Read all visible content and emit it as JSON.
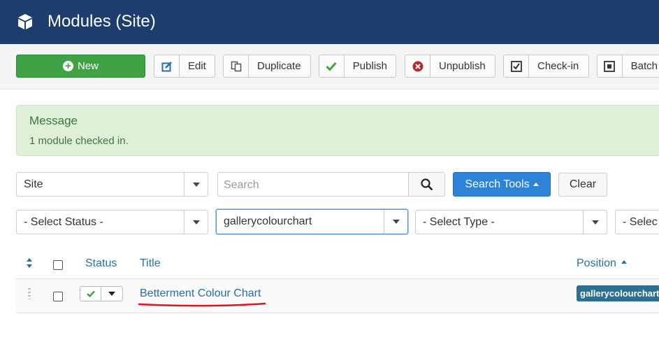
{
  "header": {
    "title": "Modules (Site)"
  },
  "toolbar": {
    "new": "New",
    "edit": "Edit",
    "duplicate": "Duplicate",
    "publish": "Publish",
    "unpublish": "Unpublish",
    "checkin": "Check-in",
    "batch": "Batch"
  },
  "message": {
    "heading": "Message",
    "text": "1 module checked in."
  },
  "filters": {
    "client": "Site",
    "search_placeholder": "Search",
    "search_tools": "Search Tools",
    "clear": "Clear",
    "status": "- Select Status -",
    "position": "gallerycolourchart",
    "type": "- Select Type -",
    "fourth": "- Selec"
  },
  "table": {
    "columns": {
      "status": "Status",
      "title": "Title",
      "position": "Position"
    },
    "rows": [
      {
        "title": "Betterment Colour Chart",
        "position": "gallerycolourchart"
      }
    ]
  },
  "colors": {
    "header_bg": "#1c3d6e",
    "new_btn": "#3fa345",
    "primary": "#2d83d6",
    "annotation": "#e0141e"
  }
}
